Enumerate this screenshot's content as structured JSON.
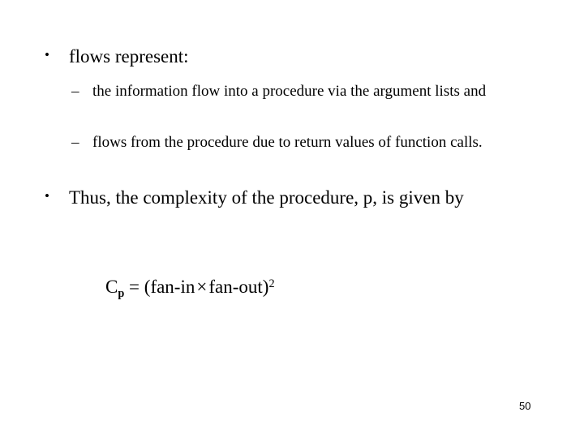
{
  "slide": {
    "background_color": "#ffffff",
    "text_color": "#000000",
    "page_number": "50",
    "bullet_glyph": "•",
    "dash_glyph": "–",
    "body": [
      {
        "level": 1,
        "marker": "•",
        "text": "flows represent:"
      },
      {
        "level": 2,
        "marker": "–",
        "text": " the information flow into a procedure via the argument lists and"
      },
      {
        "level": 2,
        "marker": "–",
        "text": "flows from the procedure due to return values of function calls."
      },
      {
        "level": 1,
        "marker": "•",
        "text": "Thus, the complexity of the procedure, p, is given by"
      }
    ],
    "formula": {
      "lhs_symbol": "C",
      "lhs_subscript": "p",
      "equals": "=",
      "open_paren": "(",
      "first_term": "fan-in",
      "operator": "×",
      "second_term": "fan-out",
      "close_paren": ")",
      "exponent": "2",
      "plain": "Cp = (fan-in × fan-out)2"
    }
  }
}
